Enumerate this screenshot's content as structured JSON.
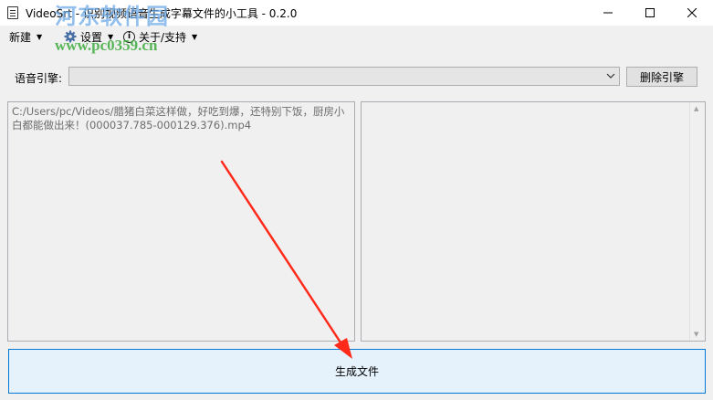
{
  "window": {
    "title": "VideoSrt - 识别视频语音生成字幕文件的小工具 - 0.2.0",
    "icon": "document-icon"
  },
  "watermark": {
    "site_name": "河东软件园",
    "url": "www.pc0359.cn"
  },
  "menu": {
    "items": [
      {
        "label": "新建",
        "icon": null
      },
      {
        "label": "设置",
        "icon": "gear-icon"
      },
      {
        "label": "关于/支持",
        "icon": "info-icon"
      }
    ]
  },
  "engine": {
    "label": "语音引擎:",
    "selected": "",
    "delete_label": "删除引擎"
  },
  "panels": {
    "left_text": "C:/Users/pc/Videos/腊猪白菜这样做，好吃到爆，还特别下饭，厨房小白都能做出来！(000037.785-000129.376).mp4",
    "right_text": ""
  },
  "actions": {
    "generate_label": "生成文件"
  },
  "colors": {
    "accent": "#0078d7",
    "button_hover_bg": "#e5f1fb",
    "arrow": "#ff2a1a",
    "watermark_blue": "#6eaae6",
    "watermark_green": "#3caa3c"
  }
}
